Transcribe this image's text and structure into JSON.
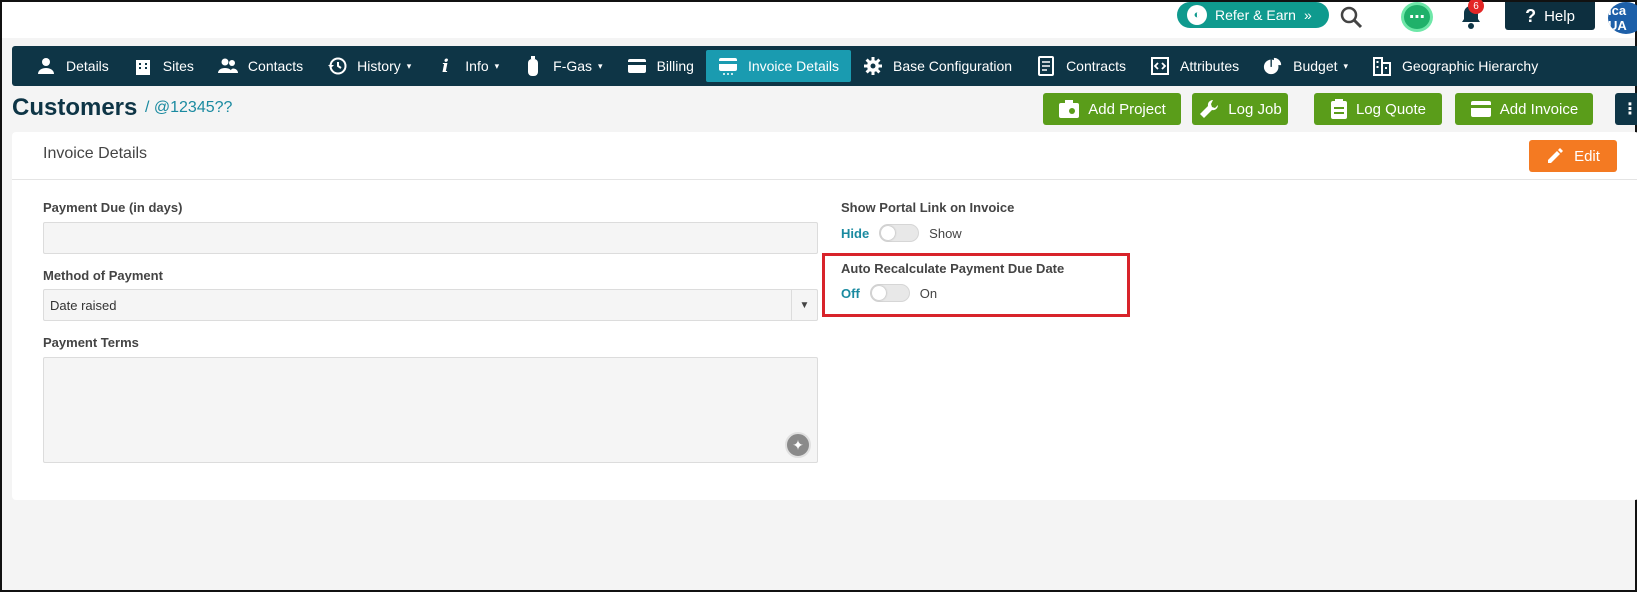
{
  "topbar": {
    "refer_label": "Refer & Earn",
    "refer_suffix": "»",
    "help_label": "Help",
    "notification_count": "6",
    "avatar_initials": "ica UA"
  },
  "nav": {
    "items": [
      {
        "label": "Details",
        "icon": "user-icon",
        "caret": ""
      },
      {
        "label": "Sites",
        "icon": "building-icon",
        "caret": ""
      },
      {
        "label": "Contacts",
        "icon": "users-icon",
        "caret": ""
      },
      {
        "label": "History",
        "icon": "history-icon",
        "caret": "▾"
      },
      {
        "label": "Info",
        "icon": "info-icon",
        "caret": "▾"
      },
      {
        "label": "F-Gas",
        "icon": "gas-cylinder-icon",
        "caret": "▾"
      },
      {
        "label": "Billing",
        "icon": "card-icon",
        "caret": ""
      },
      {
        "label": "Invoice Details",
        "icon": "invoice-card-icon",
        "caret": ""
      },
      {
        "label": "Base Configuration",
        "icon": "gear-icon",
        "caret": ""
      },
      {
        "label": "Contracts",
        "icon": "contract-icon",
        "caret": ""
      },
      {
        "label": "Attributes",
        "icon": "attributes-icon",
        "caret": ""
      },
      {
        "label": "Budget",
        "icon": "budget-icon",
        "caret": "▾"
      },
      {
        "label": "Geographic Hierarchy",
        "icon": "hierarchy-icon",
        "caret": ""
      }
    ],
    "active_index": 7
  },
  "header": {
    "title": "Customers",
    "breadcrumb": "/ @12345??",
    "actions": {
      "add_project": "Add Project",
      "log_job": "Log Job",
      "log_quote": "Log Quote",
      "add_invoice": "Add Invoice"
    }
  },
  "card": {
    "title": "Invoice Details",
    "edit_label": "Edit",
    "payment_due": {
      "label": "Payment Due (in days)",
      "value": ""
    },
    "method_of_payment": {
      "label": "Method of Payment",
      "value": "Date raised"
    },
    "payment_terms": {
      "label": "Payment Terms",
      "value": ""
    },
    "portal_link": {
      "label": "Show Portal Link on Invoice",
      "off_label": "Hide",
      "on_label": "Show"
    },
    "auto_recalc": {
      "label": "Auto Recalculate Payment Due Date",
      "off_label": "Off",
      "on_label": "On"
    }
  },
  "colors": {
    "navbar": "#0e3546",
    "active_tab": "#1a9bb0",
    "action_green": "#5a9d1a",
    "edit_orange": "#f47a22",
    "highlight_red": "#d8232a"
  }
}
